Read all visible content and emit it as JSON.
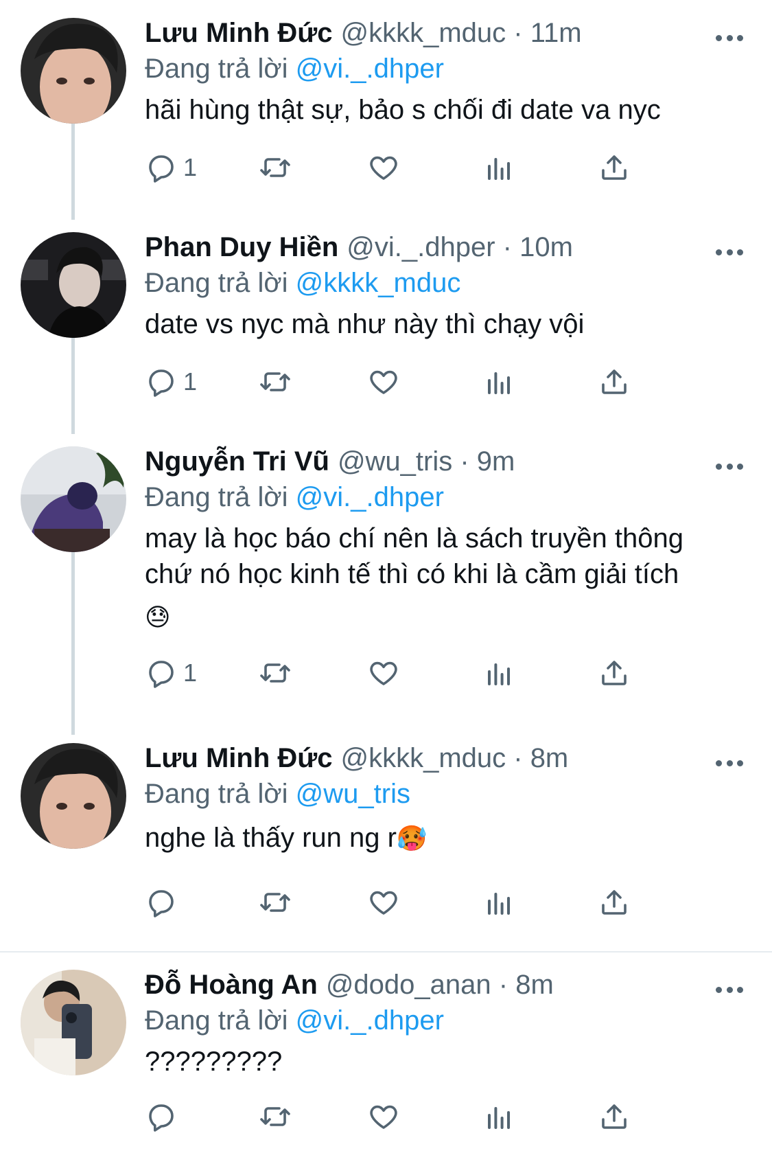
{
  "colors": {
    "accent": "#1d9bf0",
    "text": "#0f1419",
    "muted": "#536471",
    "divider": "#e6ecf0",
    "thread_line": "#cfd9de"
  },
  "tweets": [
    {
      "name": "Lưu Minh Đức",
      "handle": "@kkkk_mduc",
      "time": "11m",
      "reply_prefix": "Đang trả lời",
      "reply_to": "@vi._.dhper",
      "lines": [
        "hãi hùng thật sự, bảo s chối đi date va nyc"
      ],
      "reply_count": "1"
    },
    {
      "name": "Phan Duy Hiền",
      "handle": "@vi._.dhper",
      "time": "10m",
      "reply_prefix": "Đang trả lời",
      "reply_to": "@kkkk_mduc",
      "lines": [
        "date vs nyc mà như này thì chạy vội"
      ],
      "reply_count": "1"
    },
    {
      "name": "Nguyễn Tri Vũ",
      "handle": "@wu_tris",
      "time": "9m",
      "reply_prefix": "Đang trả lời",
      "reply_to": "@vi._.dhper",
      "lines": [
        "may là học báo chí nên là sách truyền thông",
        "chứ nó học kinh tế thì có khi là cầm giải tích"
      ],
      "emoji": "😓",
      "reply_count": "1"
    },
    {
      "name": "Lưu Minh Đức",
      "handle": "@kkkk_mduc",
      "time": "8m",
      "reply_prefix": "Đang trả lời",
      "reply_to": "@wu_tris",
      "lines": [
        "nghe là thấy run ng r"
      ],
      "emoji": "🥵",
      "reply_count": ""
    },
    {
      "name": "Đỗ Hoàng An",
      "handle": "@dodo_anan",
      "time": "8m",
      "reply_prefix": "Đang trả lời",
      "reply_to": "@vi._.dhper",
      "lines": [
        "?????????"
      ],
      "reply_count": ""
    }
  ],
  "icons": {
    "reply": "reply-icon",
    "retweet": "retweet-icon",
    "like": "heart-icon",
    "views": "views-icon",
    "share": "share-icon",
    "more": "more-icon"
  }
}
